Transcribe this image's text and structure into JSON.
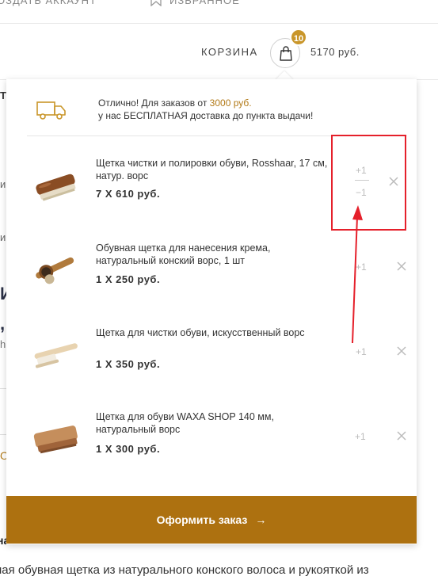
{
  "topbar": {
    "create_account": "ОЗДАТЬ АККАУНТ",
    "favorites": "ИЗБРАННОЕ"
  },
  "cart": {
    "label": "КОРЗИНА",
    "count": "10",
    "total": "5170 руб."
  },
  "promo": {
    "line1_prefix": "Отлично! Для заказов от ",
    "line1_amount": "3000 руб.",
    "line2": "у нас БЕСПЛАТНАЯ доставка до пункта выдачи!"
  },
  "items": [
    {
      "title": "Щетка чистки и полировки обуви, Rosshaar, 17 см, натур. ворс",
      "price": "7 X 610 руб.",
      "plus": "+1",
      "minus": "−1",
      "icon": "shoe-brush-dark"
    },
    {
      "title": "Обувная щетка для нанесения крема, натуральный конский ворс, 1 шт",
      "price": "1 X 250 руб.",
      "plus": "+1",
      "icon": "dauber-brush"
    },
    {
      "title": "Щетка для чистки обуви, искусственный ворс",
      "price": "1 X 350 руб.",
      "plus": "+1",
      "icon": "light-brush"
    },
    {
      "title": "Щетка для обуви WAXA SHOP 140 мм, натуральный ворс",
      "price": "1 X 300 руб.",
      "plus": "+1",
      "icon": "wood-brush"
    }
  ],
  "checkout": {
    "label": "Оформить заказ",
    "arrow": "→"
  },
  "background": {
    "bottom_bold": "на",
    "bottom_line": "ная обувная щетка из натурального конского волоса и рукояткой из",
    "frag_te": "ТЕ",
    "frag_i": "и",
    "frag_big_i": "И",
    "frag_comma": ",",
    "frag_h": "h",
    "frag_o": "О"
  },
  "colors": {
    "accent": "#c9962a",
    "checkout": "#ad7110",
    "annotation": "#e5202b"
  }
}
